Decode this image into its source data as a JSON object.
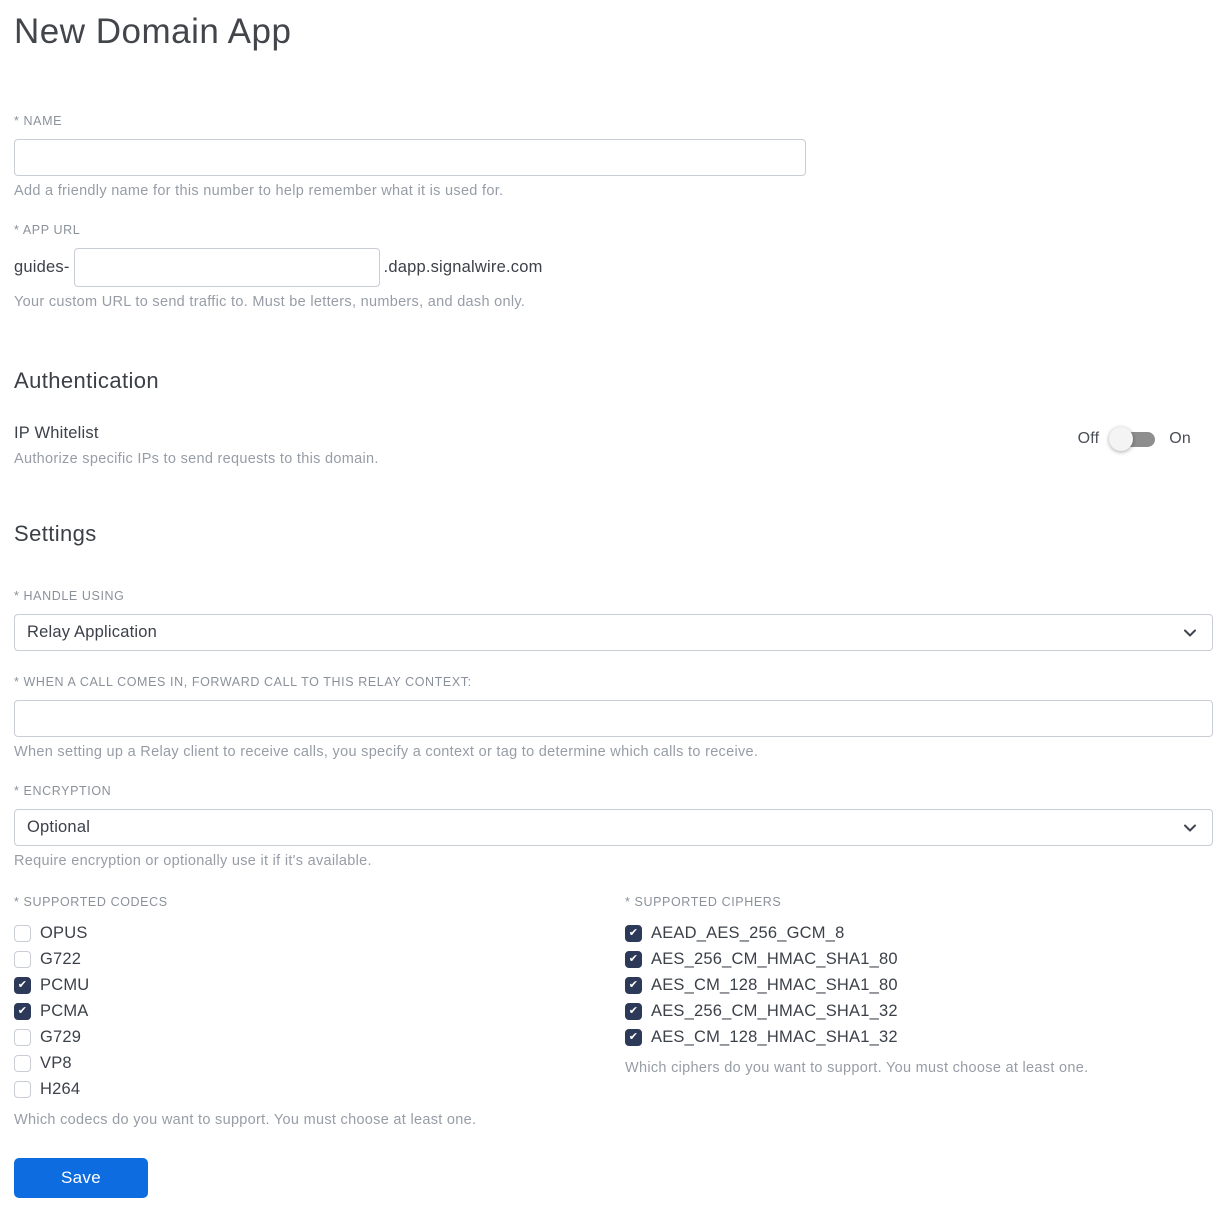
{
  "page": {
    "title": "New Domain App"
  },
  "form": {
    "name": {
      "label": "* NAME",
      "value": "",
      "help": "Add a friendly name for this number to help remember what it is used for."
    },
    "app_url": {
      "label": "* APP URL",
      "prefix": "guides-",
      "value": "",
      "suffix": ".dapp.signalwire.com",
      "help": "Your custom URL to send traffic to. Must be letters, numbers, and dash only."
    }
  },
  "authentication": {
    "heading": "Authentication",
    "ip_whitelist": {
      "label": "IP Whitelist",
      "description": "Authorize specific IPs to send requests to this domain.",
      "off_label": "Off",
      "on_label": "On",
      "state": "off"
    }
  },
  "settings": {
    "heading": "Settings",
    "handle_using": {
      "label": "* HANDLE USING",
      "selected": "Relay Application"
    },
    "relay_context": {
      "label": "* WHEN A CALL COMES IN, FORWARD CALL TO THIS RELAY CONTEXT:",
      "value": "",
      "help": "When setting up a Relay client to receive calls, you specify a context or tag to determine which calls to receive."
    },
    "encryption": {
      "label": "* ENCRYPTION",
      "selected": "Optional",
      "help": "Require encryption or optionally use it if it's available."
    },
    "codecs": {
      "label": "* SUPPORTED CODECS",
      "options": [
        {
          "label": "OPUS",
          "checked": false
        },
        {
          "label": "G722",
          "checked": false
        },
        {
          "label": "PCMU",
          "checked": true
        },
        {
          "label": "PCMA",
          "checked": true
        },
        {
          "label": "G729",
          "checked": false
        },
        {
          "label": "VP8",
          "checked": false
        },
        {
          "label": "H264",
          "checked": false
        }
      ],
      "help": "Which codecs do you want to support. You must choose at least one."
    },
    "ciphers": {
      "label": "* SUPPORTED CIPHERS",
      "options": [
        {
          "label": "AEAD_AES_256_GCM_8",
          "checked": true
        },
        {
          "label": "AES_256_CM_HMAC_SHA1_80",
          "checked": true
        },
        {
          "label": "AES_CM_128_HMAC_SHA1_80",
          "checked": true
        },
        {
          "label": "AES_256_CM_HMAC_SHA1_32",
          "checked": true
        },
        {
          "label": "AES_CM_128_HMAC_SHA1_32",
          "checked": true
        }
      ],
      "help": "Which ciphers do you want to support. You must choose at least one."
    }
  },
  "actions": {
    "save_label": "Save"
  },
  "colors": {
    "accent_blue": "#0d6cdf",
    "checkbox_navy": "#2d3958",
    "toggle_track_gray": "#8e8e8e"
  }
}
